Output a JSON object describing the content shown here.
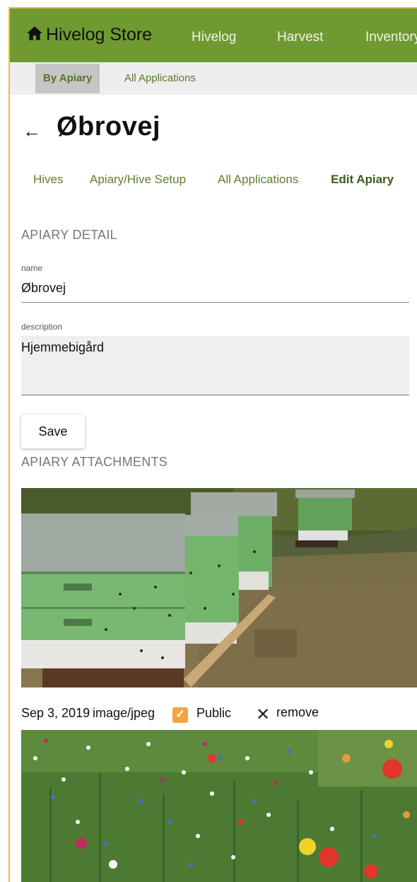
{
  "app": {
    "title": "Hivelog Store",
    "home_icon": "home-icon"
  },
  "nav": {
    "items": [
      "Hivelog",
      "Harvest",
      "Inventory"
    ]
  },
  "subnav": {
    "items": [
      "By Apiary",
      "All Applications"
    ],
    "active": "By Apiary"
  },
  "page": {
    "back_icon": "back-arrow-icon",
    "back_label": "←",
    "title": "Øbrovej"
  },
  "tabs": {
    "items": [
      "Hives",
      "Apiary/Hive Setup",
      "All Applications",
      "Edit Apiary"
    ],
    "active": "Edit Apiary"
  },
  "detail": {
    "heading": "APIARY DETAIL",
    "name_label": "name",
    "name_value": "Øbrovej",
    "description_label": "description",
    "description_value": "Hjemmebigård",
    "save_label": "Save"
  },
  "attachments": {
    "heading": "APIARY ATTACHMENTS",
    "items": [
      {
        "date": "Sep 3, 2019",
        "type": "image/jpeg",
        "public_label": "Public",
        "public_checked": true,
        "remove_label": "remove"
      }
    ]
  },
  "colors": {
    "header_green": "#6f9a32",
    "accent_orange": "#f5b933",
    "checkbox_orange": "#f2a640",
    "tab_green": "#5e7d2e"
  }
}
